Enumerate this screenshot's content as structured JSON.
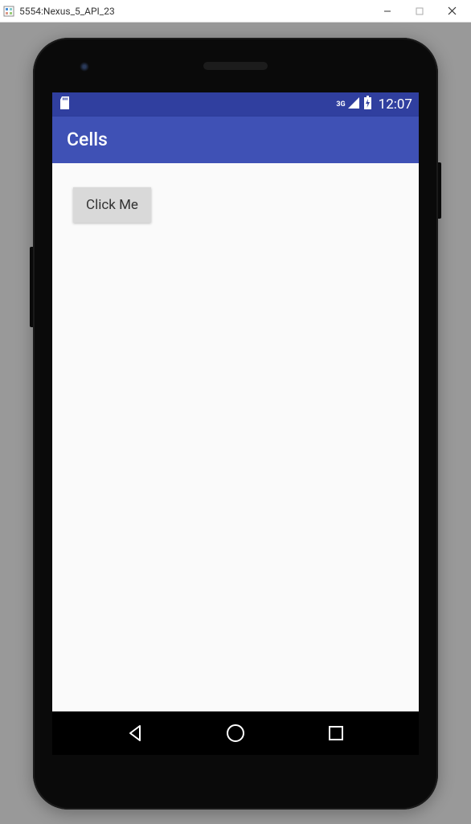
{
  "window": {
    "title": "5554:Nexus_5_API_23"
  },
  "statusBar": {
    "networkType": "3G",
    "time": "12:07"
  },
  "appBar": {
    "title": "Cells"
  },
  "content": {
    "buttonLabel": "Click Me"
  }
}
